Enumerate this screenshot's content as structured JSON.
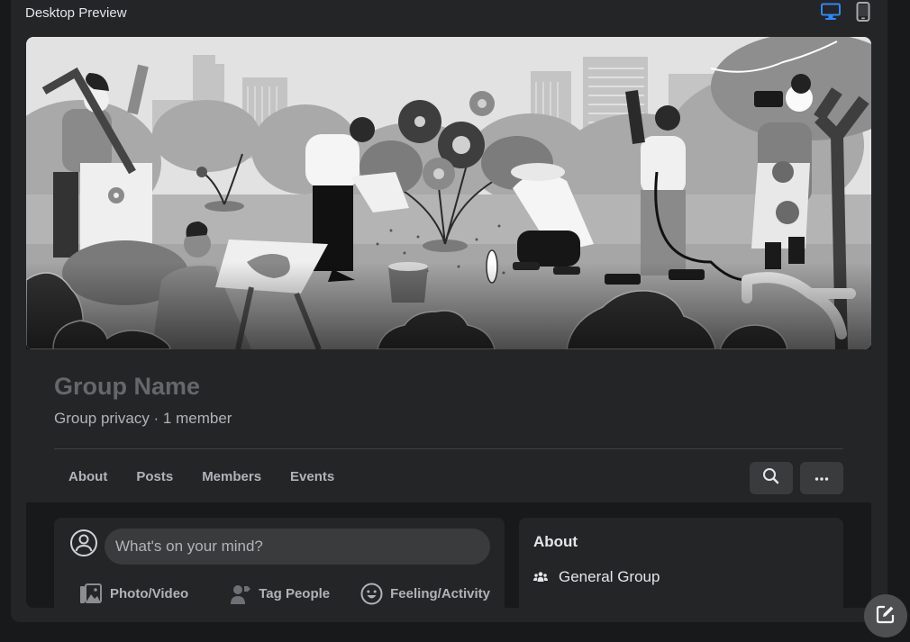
{
  "preview": {
    "title": "Desktop Preview",
    "devices": [
      {
        "name": "desktop",
        "icon": "desktop-icon",
        "active": true
      },
      {
        "name": "mobile",
        "icon": "mobile-icon",
        "active": false
      }
    ],
    "accent_color": "#2d88ff"
  },
  "cover": {
    "description": "Grayscale illustration of people gardening in a city park",
    "icon": "cover-illustration"
  },
  "group": {
    "name": "Group Name",
    "meta": "Group privacy · 1 member"
  },
  "tabs": [
    {
      "label": "About"
    },
    {
      "label": "Posts"
    },
    {
      "label": "Members"
    },
    {
      "label": "Events"
    }
  ],
  "header_buttons": {
    "search_icon": "search-icon",
    "more_icon": "more-horizontal-icon"
  },
  "composer": {
    "placeholder": "What's on your mind?",
    "avatar_icon": "user-circle-icon",
    "actions": [
      {
        "label": "Photo/Video",
        "icon": "photo-video-icon"
      },
      {
        "label": "Tag People",
        "icon": "tag-people-icon"
      },
      {
        "label": "Feeling/Activity",
        "icon": "feeling-icon"
      }
    ]
  },
  "about": {
    "title": "About",
    "items": [
      {
        "label": "General Group",
        "icon": "group-icon"
      }
    ]
  },
  "fab": {
    "icon": "edit-icon"
  }
}
